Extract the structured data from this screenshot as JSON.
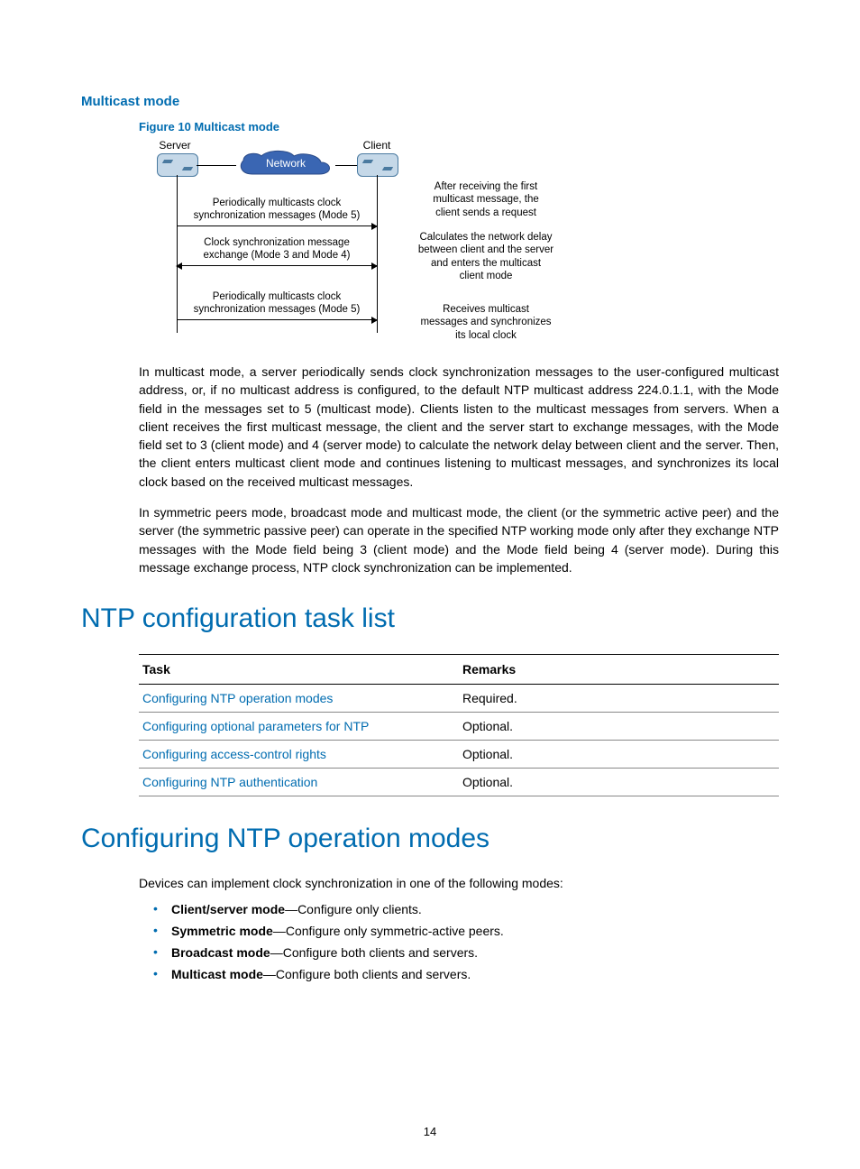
{
  "headings": {
    "multicast": "Multicast mode",
    "figcaption": "Figure 10 Multicast mode",
    "h1_tasklist": "NTP configuration task list",
    "h1_opmodes": "Configuring NTP operation modes"
  },
  "diagram": {
    "server": "Server",
    "client": "Client",
    "network": "Network",
    "msg1": "Periodically multicasts clock\nsynchronization messages (Mode 5)",
    "msg2": "Clock synchronization message\nexchange (Mode 3 and Mode 4)",
    "msg3": "Periodically multicasts clock\nsynchronization messages (Mode 5)",
    "side1": "After receiving the first\nmulticast message, the\nclient sends a request",
    "side2": "Calculates the network delay\nbetween client and the server\nand enters the multicast\nclient mode",
    "side3": "Receives multicast\nmessages and synchronizes\nits local clock"
  },
  "paragraphs": {
    "p1": "In multicast mode, a server periodically sends clock synchronization messages to the user-configured multicast address, or, if no multicast address is configured, to the default NTP multicast address 224.0.1.1, with the Mode field in the messages set to 5 (multicast mode). Clients listen to the multicast messages from servers. When a client receives the first multicast message, the client and the server start to exchange messages, with the Mode field set to 3 (client mode) and 4 (server mode) to calculate the network delay between client and the server. Then, the client enters multicast client mode and continues listening to multicast messages, and synchronizes its local clock based on the received multicast messages.",
    "p2": "In symmetric peers mode, broadcast mode and multicast mode, the client (or the symmetric active peer) and the server (the symmetric passive peer) can operate in the specified NTP working mode only after they exchange NTP messages with the Mode field being 3 (client mode) and the Mode field being 4 (server mode). During this message exchange process, NTP clock synchronization can be implemented.",
    "p3": "Devices can implement clock synchronization in one of the following modes:"
  },
  "table": {
    "col_task": "Task",
    "col_remarks": "Remarks",
    "rows": [
      {
        "task": "Configuring NTP operation modes",
        "remarks": "Required."
      },
      {
        "task": "Configuring optional parameters for NTP",
        "remarks": "Optional."
      },
      {
        "task": "Configuring access-control rights",
        "remarks": "Optional."
      },
      {
        "task": "Configuring NTP authentication",
        "remarks": "Optional."
      }
    ]
  },
  "modes": [
    {
      "name": "Client/server mode",
      "desc": "—Configure only clients."
    },
    {
      "name": "Symmetric mode",
      "desc": "—Configure only symmetric-active peers."
    },
    {
      "name": "Broadcast mode",
      "desc": "—Configure both clients and servers."
    },
    {
      "name": "Multicast mode",
      "desc": "—Configure both clients and servers."
    }
  ],
  "pagenum": "14"
}
